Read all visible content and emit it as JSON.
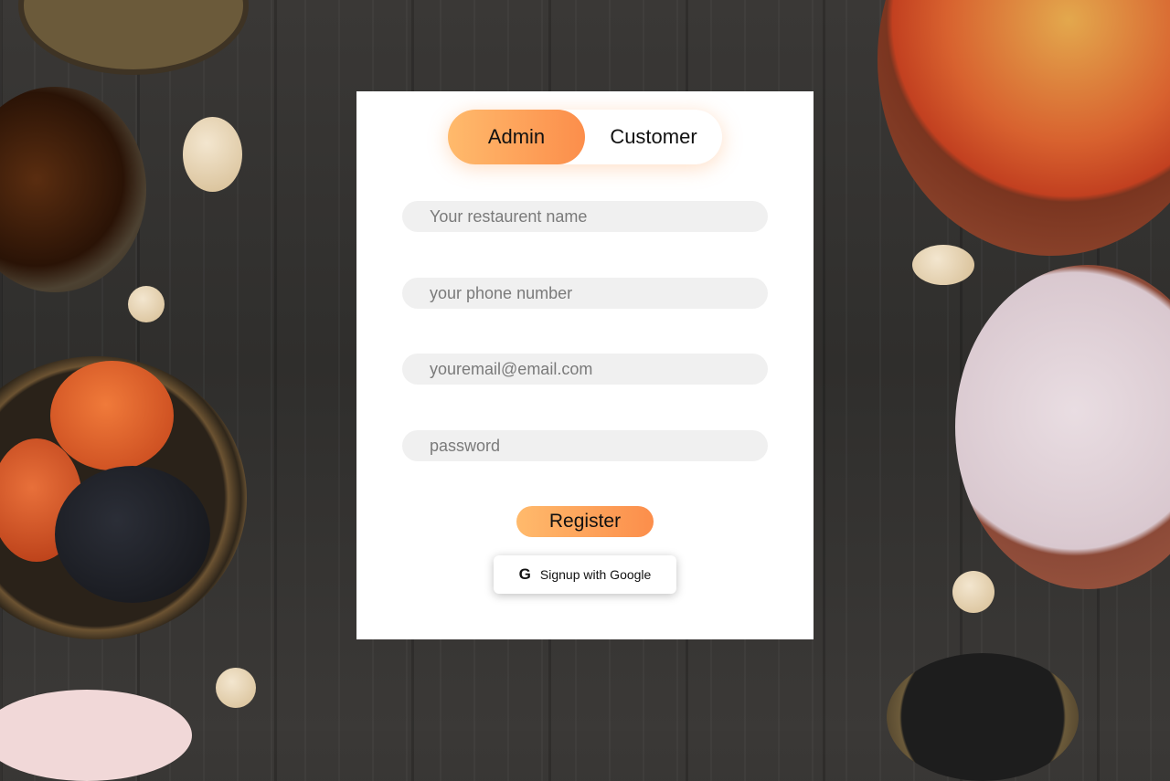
{
  "toggle": {
    "admin_label": "Admin",
    "customer_label": "Customer",
    "active": "Admin"
  },
  "form": {
    "restaurant_placeholder": "Your restaurent name",
    "phone_placeholder": "your phone number",
    "email_placeholder": "youremail@email.com",
    "password_placeholder": "password",
    "register_label": "Register",
    "google_label": "Signup with Google",
    "google_icon": "google-g-icon"
  },
  "colors": {
    "accent_start": "#ffba6c",
    "accent_end": "#fc8e4b",
    "field_bg": "#f0f0f0"
  }
}
